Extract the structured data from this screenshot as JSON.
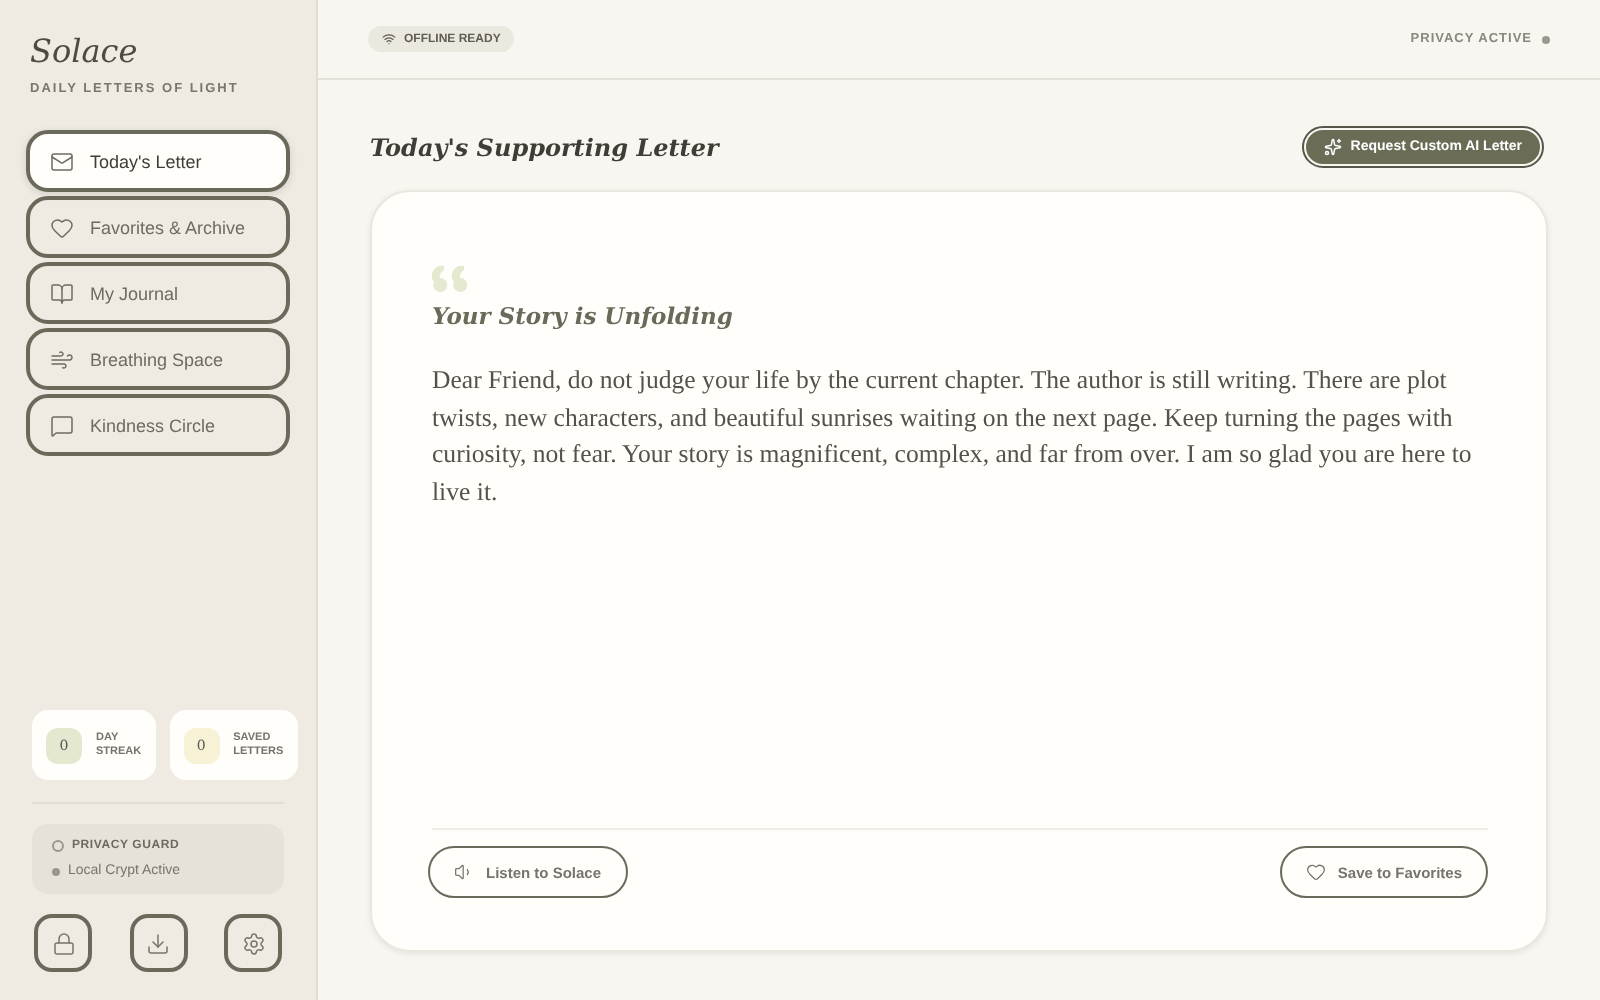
{
  "brand": {
    "name": "Solace",
    "tagline": "DAILY LETTERS OF LIGHT"
  },
  "nav": [
    {
      "kind": "mail",
      "label": "Today's Letter",
      "selected": true
    },
    {
      "kind": "heart",
      "label": "Favorites & Archive",
      "selected": false
    },
    {
      "kind": "book",
      "label": "My Journal",
      "selected": false
    },
    {
      "kind": "wind",
      "label": "Breathing Space",
      "selected": false
    },
    {
      "kind": "chat",
      "label": "Kindness Circle",
      "selected": false
    }
  ],
  "stats": [
    {
      "value": "0",
      "label_1": "DAY",
      "label_2": "STREAK",
      "color": "#e3e8cf"
    },
    {
      "value": "0",
      "label_1": "SAVED",
      "label_2": "LETTERS",
      "color": "#f7f1d6"
    }
  ],
  "privacy_guard": {
    "title": "PRIVACY GUARD",
    "status": "Local Crypt Active"
  },
  "tools": [
    {
      "kind": "lock"
    },
    {
      "kind": "download"
    },
    {
      "kind": "settings"
    }
  ],
  "header": {
    "badge": "OFFLINE READY",
    "privacy": "PRIVACY ACTIVE"
  },
  "page_title": "Today's Supporting Letter",
  "request_button": "Request Custom AI Letter",
  "letter": {
    "title": "Your Story is Unfolding",
    "body": "Dear Friend, do not judge your life by the current chapter. The author is still writing. There are plot twists, new characters, and beautiful sunrises waiting on the next page. Keep turning the pages with curiosity, not fear. Your story is magnificent, complex, and far from over. I am so glad you are here to live it."
  },
  "actions": [
    {
      "kind": "listen",
      "label": "Listen to Solace"
    },
    {
      "kind": "save",
      "label": "Save to Favorites"
    }
  ]
}
